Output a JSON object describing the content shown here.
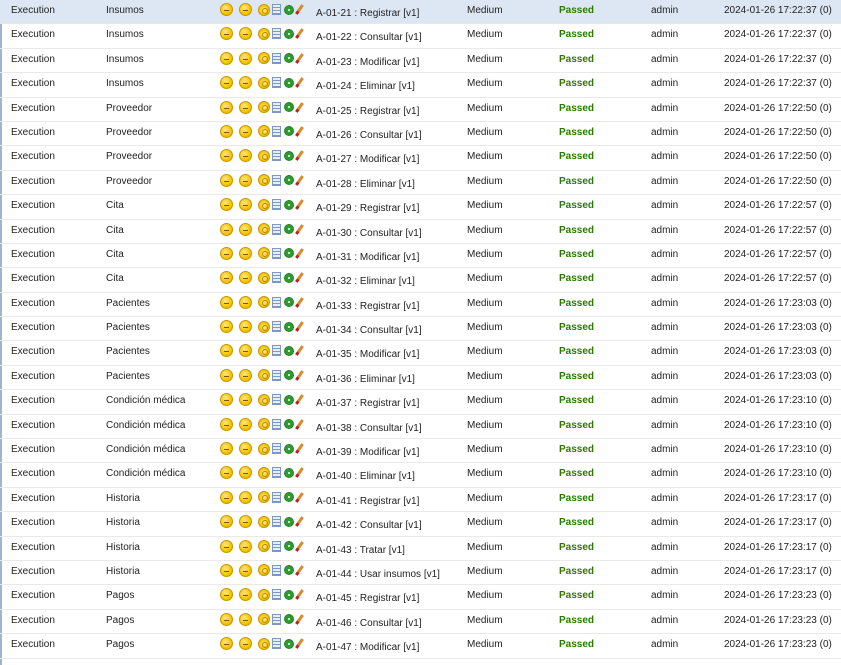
{
  "rows": [
    {
      "type": "Execution",
      "module": "Insumos",
      "test": "A-01-21 : Registrar [v1]",
      "priority": "Medium",
      "status": "Passed",
      "user": "admin",
      "date": "2024-01-26 17:22:37 (0)"
    },
    {
      "type": "Execution",
      "module": "Insumos",
      "test": "A-01-22 : Consultar [v1]",
      "priority": "Medium",
      "status": "Passed",
      "user": "admin",
      "date": "2024-01-26 17:22:37 (0)"
    },
    {
      "type": "Execution",
      "module": "Insumos",
      "test": "A-01-23 : Modificar [v1]",
      "priority": "Medium",
      "status": "Passed",
      "user": "admin",
      "date": "2024-01-26 17:22:37 (0)"
    },
    {
      "type": "Execution",
      "module": "Insumos",
      "test": "A-01-24 : Eliminar [v1]",
      "priority": "Medium",
      "status": "Passed",
      "user": "admin",
      "date": "2024-01-26 17:22:37 (0)"
    },
    {
      "type": "Execution",
      "module": "Proveedor",
      "test": "A-01-25 : Registrar [v1]",
      "priority": "Medium",
      "status": "Passed",
      "user": "admin",
      "date": "2024-01-26 17:22:50 (0)"
    },
    {
      "type": "Execution",
      "module": "Proveedor",
      "test": "A-01-26 : Consultar [v1]",
      "priority": "Medium",
      "status": "Passed",
      "user": "admin",
      "date": "2024-01-26 17:22:50 (0)"
    },
    {
      "type": "Execution",
      "module": "Proveedor",
      "test": "A-01-27 : Modificar [v1]",
      "priority": "Medium",
      "status": "Passed",
      "user": "admin",
      "date": "2024-01-26 17:22:50 (0)"
    },
    {
      "type": "Execution",
      "module": "Proveedor",
      "test": "A-01-28 : Eliminar [v1]",
      "priority": "Medium",
      "status": "Passed",
      "user": "admin",
      "date": "2024-01-26 17:22:50 (0)"
    },
    {
      "type": "Execution",
      "module": "Cita",
      "test": "A-01-29 : Registrar [v1]",
      "priority": "Medium",
      "status": "Passed",
      "user": "admin",
      "date": "2024-01-26 17:22:57 (0)"
    },
    {
      "type": "Execution",
      "module": "Cita",
      "test": "A-01-30 : Consultar [v1]",
      "priority": "Medium",
      "status": "Passed",
      "user": "admin",
      "date": "2024-01-26 17:22:57 (0)"
    },
    {
      "type": "Execution",
      "module": "Cita",
      "test": "A-01-31 : Modificar [v1]",
      "priority": "Medium",
      "status": "Passed",
      "user": "admin",
      "date": "2024-01-26 17:22:57 (0)"
    },
    {
      "type": "Execution",
      "module": "Cita",
      "test": "A-01-32 : Eliminar [v1]",
      "priority": "Medium",
      "status": "Passed",
      "user": "admin",
      "date": "2024-01-26 17:22:57 (0)"
    },
    {
      "type": "Execution",
      "module": "Pacientes",
      "test": "A-01-33 : Registrar [v1]",
      "priority": "Medium",
      "status": "Passed",
      "user": "admin",
      "date": "2024-01-26 17:23:03 (0)"
    },
    {
      "type": "Execution",
      "module": "Pacientes",
      "test": "A-01-34 : Consultar [v1]",
      "priority": "Medium",
      "status": "Passed",
      "user": "admin",
      "date": "2024-01-26 17:23:03 (0)"
    },
    {
      "type": "Execution",
      "module": "Pacientes",
      "test": "A-01-35 : Modificar [v1]",
      "priority": "Medium",
      "status": "Passed",
      "user": "admin",
      "date": "2024-01-26 17:23:03 (0)"
    },
    {
      "type": "Execution",
      "module": "Pacientes",
      "test": "A-01-36 : Eliminar [v1]",
      "priority": "Medium",
      "status": "Passed",
      "user": "admin",
      "date": "2024-01-26 17:23:03 (0)"
    },
    {
      "type": "Execution",
      "module": "Condición médica",
      "test": "A-01-37 : Registrar [v1]",
      "priority": "Medium",
      "status": "Passed",
      "user": "admin",
      "date": "2024-01-26 17:23:10 (0)"
    },
    {
      "type": "Execution",
      "module": "Condición médica",
      "test": "A-01-38 : Consultar [v1]",
      "priority": "Medium",
      "status": "Passed",
      "user": "admin",
      "date": "2024-01-26 17:23:10 (0)"
    },
    {
      "type": "Execution",
      "module": "Condición médica",
      "test": "A-01-39 : Modificar [v1]",
      "priority": "Medium",
      "status": "Passed",
      "user": "admin",
      "date": "2024-01-26 17:23:10 (0)"
    },
    {
      "type": "Execution",
      "module": "Condición médica",
      "test": "A-01-40 : Eliminar [v1]",
      "priority": "Medium",
      "status": "Passed",
      "user": "admin",
      "date": "2024-01-26 17:23:10 (0)"
    },
    {
      "type": "Execution",
      "module": "Historia",
      "test": "A-01-41 : Registrar [v1]",
      "priority": "Medium",
      "status": "Passed",
      "user": "admin",
      "date": "2024-01-26 17:23:17 (0)"
    },
    {
      "type": "Execution",
      "module": "Historia",
      "test": "A-01-42 : Consultar [v1]",
      "priority": "Medium",
      "status": "Passed",
      "user": "admin",
      "date": "2024-01-26 17:23:17 (0)"
    },
    {
      "type": "Execution",
      "module": "Historia",
      "test": "A-01-43 : Tratar [v1]",
      "priority": "Medium",
      "status": "Passed",
      "user": "admin",
      "date": "2024-01-26 17:23:17 (0)"
    },
    {
      "type": "Execution",
      "module": "Historia",
      "test": "A-01-44 : Usar insumos [v1]",
      "priority": "Medium",
      "status": "Passed",
      "user": "admin",
      "date": "2024-01-26 17:23:17 (0)"
    },
    {
      "type": "Execution",
      "module": "Pagos",
      "test": "A-01-45 : Registrar [v1]",
      "priority": "Medium",
      "status": "Passed",
      "user": "admin",
      "date": "2024-01-26 17:23:23 (0)"
    },
    {
      "type": "Execution",
      "module": "Pagos",
      "test": "A-01-46 : Consultar [v1]",
      "priority": "Medium",
      "status": "Passed",
      "user": "admin",
      "date": "2024-01-26 17:23:23 (0)"
    },
    {
      "type": "Execution",
      "module": "Pagos",
      "test": "A-01-47 : Modificar [v1]",
      "priority": "Medium",
      "status": "Passed",
      "user": "admin",
      "date": "2024-01-26 17:23:23 (0)"
    }
  ],
  "colors": {
    "selected_row": "#dde7f4",
    "passed": "#2b7a00"
  },
  "icons": [
    "smiley-icon",
    "neutral-face-icon",
    "disc-icon",
    "note-icon",
    "gear-icon",
    "pencil-icon"
  ]
}
